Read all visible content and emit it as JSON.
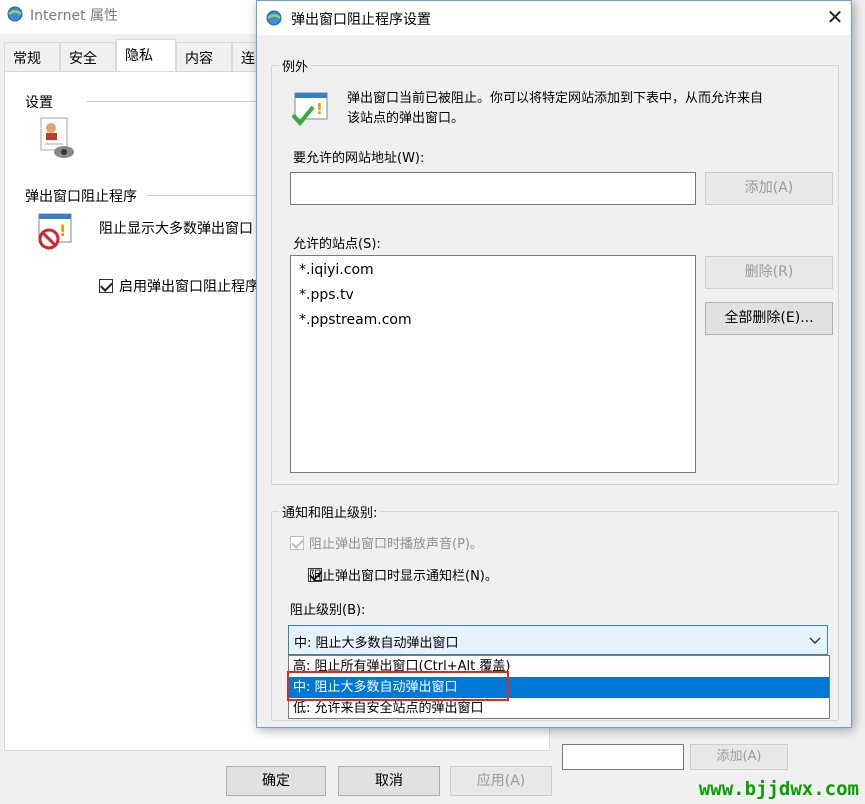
{
  "background_window": {
    "title": "Internet 属性",
    "tabs": [
      {
        "label": "常规"
      },
      {
        "label": "安全"
      },
      {
        "label": "隐私"
      },
      {
        "label": "内容"
      },
      {
        "label": "连"
      }
    ],
    "settings_label": "设置",
    "popup_blocker_label": "弹出窗口阻止程序",
    "popup_blocker_desc": "阻止显示大多数弹出窗口",
    "enable_blocker_checkbox": "启用弹出窗口阻止程序",
    "footer": {
      "ok": "确定",
      "cancel": "取消",
      "apply": "应用(A)"
    },
    "hidden_add_button": "添加(A)"
  },
  "dialog": {
    "title": "弹出窗口阻止程序设置",
    "close_glyph": "✕",
    "exceptions": {
      "legend": "例外",
      "description_line1": "弹出窗口当前已被阻止。你可以将特定网站添加到下表中，从而允许来自",
      "description_line2": "该站点的弹出窗口。",
      "address_label": "要允许的网站地址(W):",
      "address_value": "",
      "add_button": "添加(A)",
      "allowed_label": "允许的站点(S):",
      "allowed_sites": [
        "*.iqiyi.com",
        "*.pps.tv",
        "*.ppstream.com"
      ],
      "remove_button": "删除(R)",
      "remove_all_button": "全部删除(E)..."
    },
    "notifications": {
      "legend": "通知和阻止级别:",
      "play_sound": "阻止弹出窗口时播放声音(P)。",
      "show_bar": "阻止弹出窗口时显示通知栏(N)。",
      "level_label": "阻止级别(B):",
      "level_selected": "中: 阻止大多数自动弹出窗口",
      "level_options": [
        "高: 阻止所有弹出窗口(Ctrl+Alt 覆盖)",
        "中: 阻止大多数自动弹出窗口",
        "低: 允许来自安全站点的弹出窗口"
      ]
    }
  },
  "watermark": "www.bjjdwx.com",
  "colors": {
    "selection": "#0078d7",
    "highlight": "#e8261c",
    "watermark": "#0aa000"
  }
}
